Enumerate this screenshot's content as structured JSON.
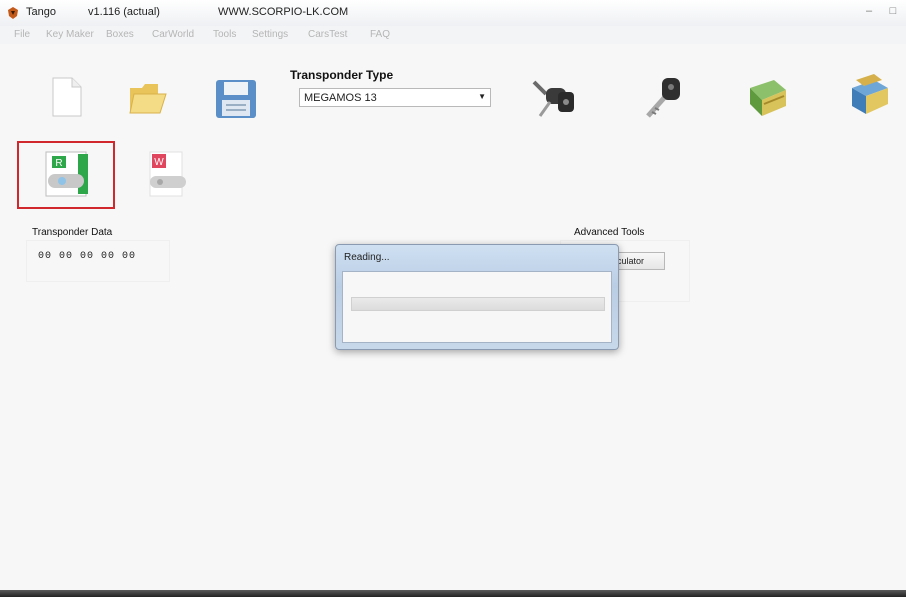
{
  "window": {
    "app_name": "Tango",
    "version": "v1.116 (actual)",
    "url": "WWW.SCORPIO-LK.COM",
    "controls": {
      "minimize": "–",
      "maximize": "□",
      "close": "✕"
    }
  },
  "menu": [
    "File",
    "Key Maker",
    "Boxes",
    "CarWorld",
    "Tools",
    "Settings",
    "CarsTest",
    "FAQ"
  ],
  "toolbar": {
    "icons": [
      "new-file-icon",
      "open-folder-icon",
      "save-disk-icon",
      "key-remote-icon",
      "key-icon",
      "book-icon",
      "books-icon"
    ],
    "read_icon": "read-transponder-icon",
    "write_icon": "write-transponder-icon"
  },
  "transponder_type": {
    "label": "Transponder Type",
    "selected": "MEGAMOS 13"
  },
  "transponder_data": {
    "label": "Transponder Data",
    "bytes": "00  00  00  00  00"
  },
  "advanced_tools": {
    "label": "Advanced Tools",
    "calculator_label": "lculator"
  },
  "dialog": {
    "title": "Reading...",
    "progress": 0
  },
  "colors": {
    "highlight": "#d0282d",
    "dialog_frame": "#b9cde4"
  }
}
